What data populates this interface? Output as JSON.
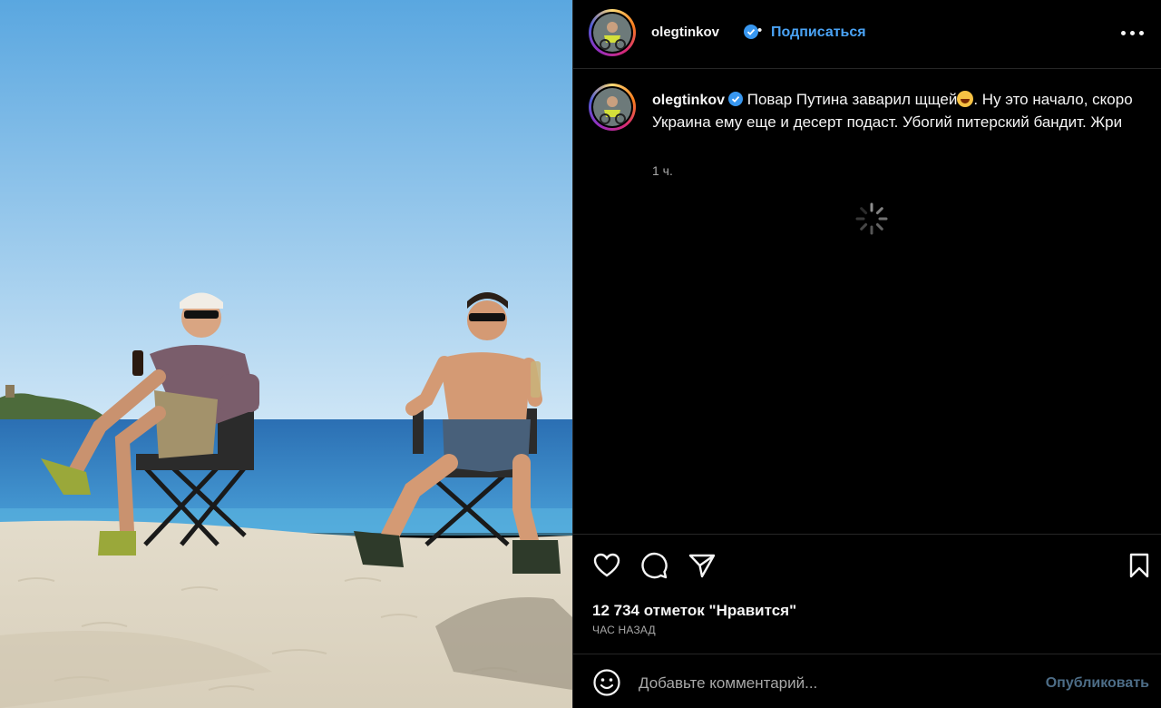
{
  "post": {
    "username": "olegtinkov",
    "follow_label": "Подписаться",
    "caption": "Повар Путина заварил щщей",
    "caption_rest": ". Ну это начало, скоро Украина ему еще и десерт подаст. Убогий питерский бандит. Жри",
    "time_short": "1 ч.",
    "likes": "12 734 отметок \"Нравится\"",
    "time_ago": "ЧАС НАЗАД"
  },
  "comment": {
    "placeholder": "Добавьте комментарий...",
    "publish_label": "Опубликовать"
  },
  "icons": [
    "more-icon",
    "verified-icon",
    "heart-icon",
    "comment-icon",
    "share-icon",
    "bookmark-icon",
    "emoji-icon",
    "spinner-icon"
  ],
  "colors": {
    "link": "#4aa3f5",
    "verified": "#3897f0",
    "muted": "#a8a8a8",
    "background": "#000000"
  }
}
